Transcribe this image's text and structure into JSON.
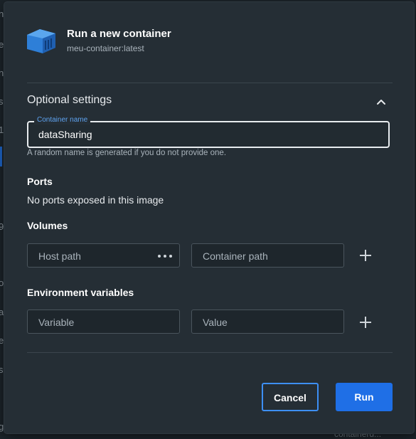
{
  "background": {
    "fragments": [
      "n",
      "e",
      "n",
      "s",
      "1",
      "9",
      "o",
      "al",
      "e-i",
      "s",
      "g"
    ],
    "bottom_text": "containerd..."
  },
  "dialog": {
    "title": "Run a new container",
    "subtitle": "meu-container:latest",
    "icon": "docker-container-icon"
  },
  "optional_settings": {
    "title": "Optional settings",
    "expanded": true
  },
  "container_name": {
    "label": "Container name",
    "value": "dataSharing",
    "helper": "A random name is generated if you do not provide one."
  },
  "ports": {
    "title": "Ports",
    "message": "No ports exposed in this image"
  },
  "volumes": {
    "title": "Volumes",
    "host_placeholder": "Host path",
    "container_placeholder": "Container path"
  },
  "env": {
    "title": "Environment variables",
    "variable_placeholder": "Variable",
    "value_placeholder": "Value"
  },
  "actions": {
    "cancel": "Cancel",
    "run": "Run"
  },
  "colors": {
    "accent": "#1f6fe6",
    "legend": "#5ea3f0",
    "dialog_bg": "#252e35"
  }
}
